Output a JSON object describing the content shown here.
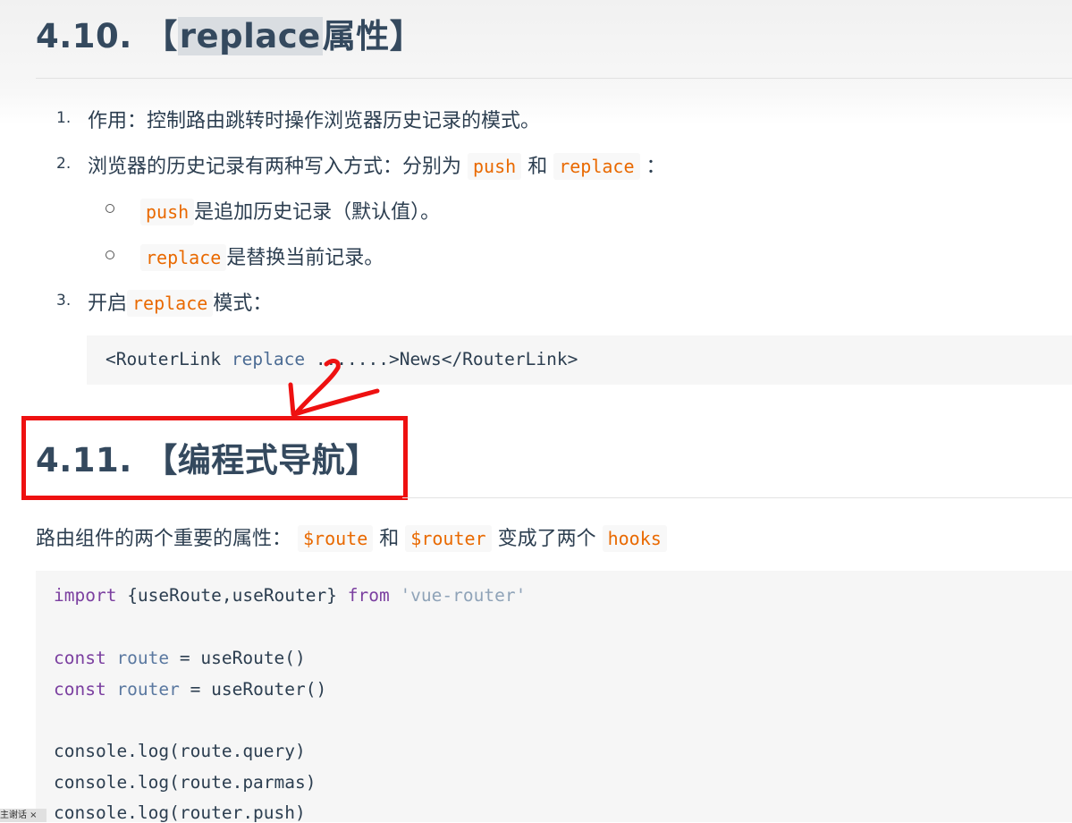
{
  "section_410": {
    "number": "4.10.",
    "bracket_open": "【",
    "highlight": "replace",
    "rest": "属性",
    "bracket_close": "】"
  },
  "list": {
    "item1": {
      "num": "1.",
      "text": "作用：控制路由跳转时操作浏览器历史记录的模式。"
    },
    "item2": {
      "num": "2.",
      "text_a": "浏览器的历史记录有两种写入方式：分别为",
      "code_a": "push",
      "text_b": "和",
      "code_b": "replace",
      "text_c": "："
    },
    "sub1": {
      "code": "push",
      "text": "是追加历史记录（默认值）。"
    },
    "sub2": {
      "code": "replace",
      "text": "是替换当前记录。"
    },
    "item3": {
      "num": "3.",
      "text_a": "开启",
      "code": "replace",
      "text_b": "模式："
    }
  },
  "code1": {
    "tag_open": "<RouterLink ",
    "attr": "replace",
    "rest": " .......>News</RouterLink>"
  },
  "section_411": {
    "number": "4.11.",
    "bracket_open": "【",
    "title": "编程式导航",
    "bracket_close": "】"
  },
  "para": {
    "text_a": "路由组件的两个重要的属性：",
    "code_a": "$route",
    "text_b": "和",
    "code_b": "$router",
    "text_c": "变成了两个",
    "code_c": "hooks"
  },
  "code2": {
    "l1_kw": "import",
    "l1_braces": " {useRoute,useRouter} ",
    "l1_from": "from",
    "l1_str": " 'vue-router'",
    "l2_kw": "const",
    "l2_var": " route",
    "l2_rest": " = useRoute()",
    "l3_kw": "const",
    "l3_var": " router",
    "l3_rest": " = useRouter()",
    "l4": "console.log(route.query)",
    "l5": "console.log(route.parmas)",
    "l6": "console.log(router.push)"
  },
  "corner": {
    "text": "主谢话 ×"
  },
  "colors": {
    "annotation": "#ee1111",
    "inline_code": "#e96900",
    "heading": "#34495e"
  }
}
